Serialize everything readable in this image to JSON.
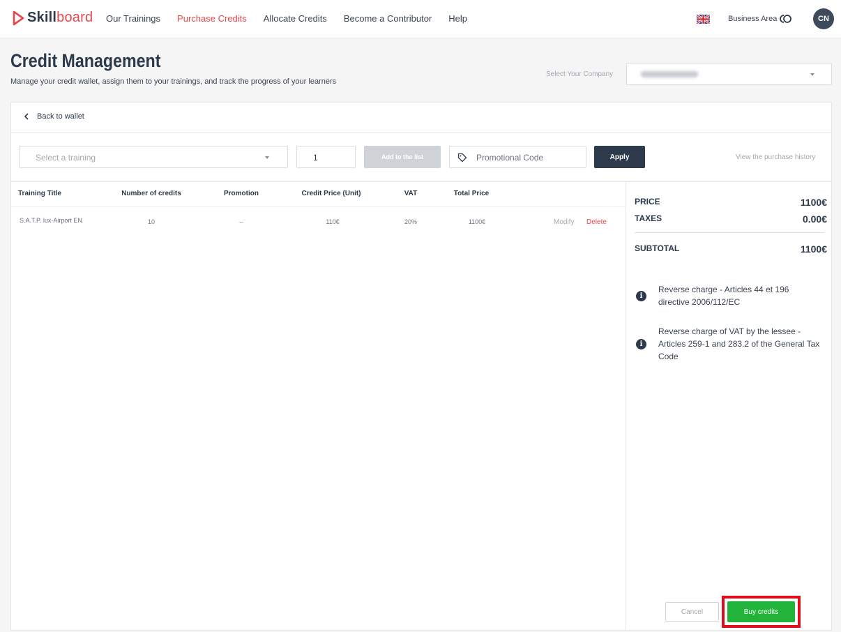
{
  "brand": {
    "part1": "Skill",
    "part2": "board"
  },
  "nav": {
    "items": [
      {
        "label": "Our Trainings",
        "active": false
      },
      {
        "label": "Purchase Credits",
        "active": true
      },
      {
        "label": "Allocate Credits",
        "active": false
      },
      {
        "label": "Become a Contributor",
        "active": false
      },
      {
        "label": "Help",
        "active": false
      }
    ],
    "business_area": "Business Area",
    "avatar_initials": "CN"
  },
  "header": {
    "title": "Credit Management",
    "subtitle": "Manage your credit wallet, assign them to your trainings, and track the progress of your learners",
    "company_label": "Select Your Company"
  },
  "toolbar": {
    "back_label": "Back to wallet",
    "training_placeholder": "Select a training",
    "quantity": "1",
    "add_label": "Add to the list",
    "promo_placeholder": "Promotional Code",
    "apply_label": "Apply",
    "history_label": "View the purchase history"
  },
  "table": {
    "headers": [
      "Training Title",
      "Number of credits",
      "Promotion",
      "Credit Price (Unit)",
      "VAT",
      "Total Price"
    ],
    "rows": [
      {
        "title": "S.A.T.P. lux-Airport EN",
        "credits": "10",
        "promotion": "--",
        "unit_price": "110€",
        "vat": "20%",
        "total": "1100€",
        "modify": "Modify",
        "delete": "Delete"
      }
    ]
  },
  "summary": {
    "price_label": "PRICE",
    "price_value": "1100€",
    "taxes_label": "TAXES",
    "taxes_value": "0.00€",
    "subtotal_label": "SUBTOTAL",
    "subtotal_value": "1100€",
    "notes": [
      "Reverse charge - Articles 44 et 196 directive 2006/112/EC",
      "Reverse charge of VAT by the lessee - Articles 259-1 and 283.2 of the General Tax Code"
    ],
    "info_glyph": "i",
    "cancel_label": "Cancel",
    "buy_label": "Buy credits"
  },
  "colors": {
    "brand_red": "#e8474a",
    "navy": "#2d3a4b",
    "buy_green": "#22b33a",
    "highlight_red": "#e0101a"
  }
}
